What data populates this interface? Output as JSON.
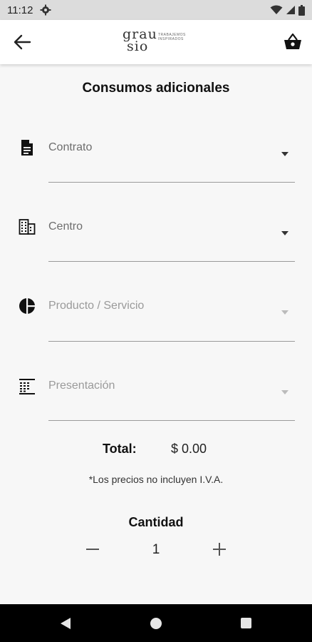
{
  "status_bar": {
    "time": "11:12",
    "icons": [
      "gear-icon",
      "wifi-icon",
      "cell-signal-icon",
      "battery-icon"
    ]
  },
  "header": {
    "back_icon": "arrow-left-icon",
    "logo": {
      "line1": "grau",
      "line2": "sio",
      "tagline": "TRABAJEMOS INSPIRADOS"
    },
    "cart_icon": "basket-icon"
  },
  "page": {
    "title": "Consumos adicionales"
  },
  "fields": [
    {
      "label": "Contrato",
      "icon": "document-icon",
      "enabled": true
    },
    {
      "label": "Centro",
      "icon": "building-icon",
      "enabled": true
    },
    {
      "label": "Producto / Servicio",
      "icon": "pie-chart-icon",
      "enabled": false
    },
    {
      "label": "Presentación",
      "icon": "table-grid-icon",
      "enabled": false
    }
  ],
  "total": {
    "label": "Total:",
    "value": "$ 0.00"
  },
  "note": "*Los precios no incluyen I.V.A.",
  "quantity": {
    "title": "Cantidad",
    "value": "1"
  },
  "colors": {
    "background": "#f7f7f7",
    "appbar": "#ffffff",
    "statusbar": "#dcdcdc",
    "navbar": "#000000",
    "underline": "#9a9a9a"
  }
}
